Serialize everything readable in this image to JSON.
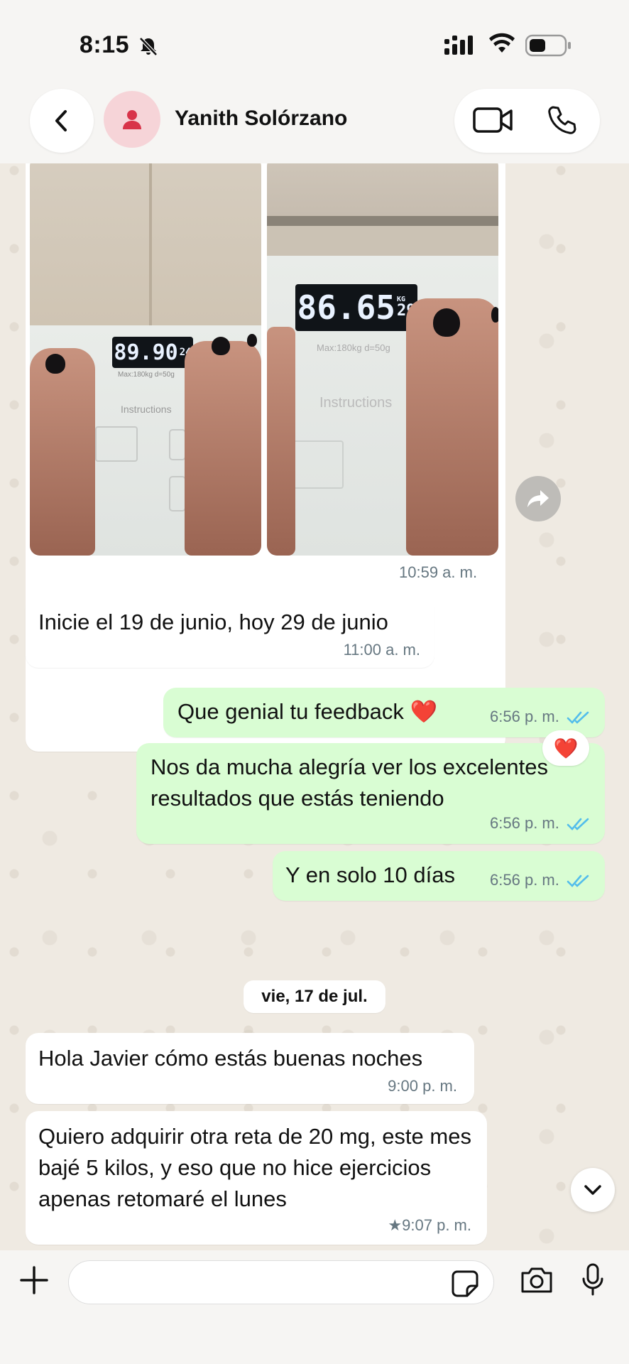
{
  "status_bar": {
    "time": "8:15",
    "icons": [
      "bell-slash-icon",
      "cellular-signal-icon",
      "wifi-icon",
      "battery-icon"
    ]
  },
  "header": {
    "contact_name": "Yanith Solórzano",
    "icons": [
      "chevron-left-icon",
      "person-icon",
      "video-camera-icon",
      "phone-icon"
    ]
  },
  "colors": {
    "wallpaper": "#efeae2",
    "incoming_bubble": "#ffffff",
    "outgoing_bubble": "#d9fdd3",
    "read_ticks": "#53bdeb",
    "meta_text": "#667781",
    "heart": "#e0212e"
  },
  "messages": [
    {
      "direction": "incoming",
      "type": "photos",
      "photos": [
        {
          "scale_reading": "89.90",
          "scale_small": "24",
          "scale_text": "Max:180kg d=50g",
          "label": "Instructions"
        },
        {
          "scale_reading": "86.65",
          "scale_small": "29",
          "scale_unit": "KG",
          "scale_text": "Max:180kg d=50g",
          "label": "Instructions"
        }
      ],
      "time": "10:59 a. m."
    },
    {
      "direction": "incoming",
      "type": "text",
      "text": "Inicie el 19 de junio, hoy 29 de junio",
      "time": "11:00 a. m."
    },
    {
      "direction": "outgoing",
      "type": "text",
      "text": "Que genial tu feedback ❤️",
      "time": "6:56 p. m.",
      "status": "read"
    },
    {
      "direction": "outgoing",
      "type": "text",
      "text": "Nos da mucha alegría ver los excelentes resultados que estás teniendo",
      "time": "6:56 p. m.",
      "status": "read"
    },
    {
      "direction": "outgoing",
      "type": "text",
      "text": "Y en solo 10 días",
      "time": "6:56 p. m.",
      "status": "read",
      "reaction": "❤️"
    },
    {
      "direction": "incoming",
      "type": "text",
      "text": "Hola Javier cómo estás buenas noches",
      "time": "9:00 p. m."
    },
    {
      "direction": "incoming",
      "type": "text",
      "text": "Quiero adquirir otra reta de 20 mg, este mes bajé 5 kilos, y eso que no hice ejercicios apenas retomaré el lunes",
      "time": "9:07 p. m.",
      "starred": true
    }
  ],
  "date_separator": "vie, 17 de jul.",
  "star_glyph": "★",
  "input_bar": {
    "placeholder": "",
    "icons": [
      "plus-icon",
      "sticker-icon",
      "camera-icon",
      "microphone-icon"
    ]
  },
  "floating": {
    "forward_icon": "forward-arrow-icon",
    "scroll_icon": "chevron-down-icon"
  }
}
